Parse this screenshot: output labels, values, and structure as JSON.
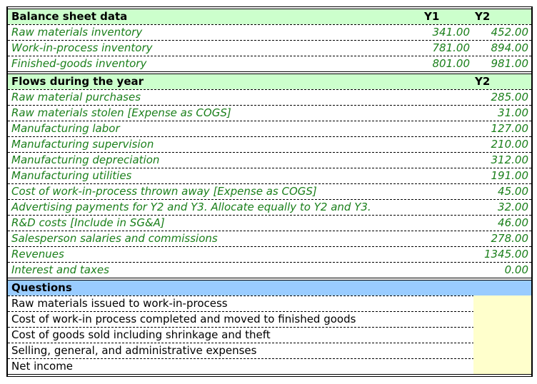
{
  "balance_sheet": {
    "title": "Balance sheet data",
    "col_y1": "Y1",
    "col_y2": "Y2",
    "rows": [
      {
        "label": "Raw materials inventory",
        "y1": "341.00",
        "y2": "452.00"
      },
      {
        "label": "Work-in-process inventory",
        "y1": "781.00",
        "y2": "894.00"
      },
      {
        "label": "Finished-goods inventory",
        "y1": "801.00",
        "y2": "981.00"
      }
    ]
  },
  "flows": {
    "title": "Flows during the year",
    "col_y2": "Y2",
    "rows": [
      {
        "label": "Raw material purchases",
        "y2": "285.00"
      },
      {
        "label": "Raw materials stolen [Expense as COGS]",
        "y2": "31.00"
      },
      {
        "label": "Manufacturing labor",
        "y2": "127.00"
      },
      {
        "label": "Manufacturing supervision",
        "y2": "210.00"
      },
      {
        "label": "Manufacturing depreciation",
        "y2": "312.00"
      },
      {
        "label": "Manufacturing utilities",
        "y2": "191.00"
      },
      {
        "label": "Cost of work-in-process thrown away [Expense as COGS]",
        "y2": "45.00"
      },
      {
        "label": "Advertising payments for Y2 and Y3. Allocate equally to Y2 and Y3.",
        "y2": "32.00"
      },
      {
        "label": "R&D costs [Include in SG&A]",
        "y2": "46.00"
      },
      {
        "label": "Salesperson salaries and commissions",
        "y2": "278.00"
      },
      {
        "label": "Revenues",
        "y2": "1345.00"
      },
      {
        "label": "Interest and taxes",
        "y2": "0.00"
      }
    ]
  },
  "questions": {
    "title": "Questions",
    "rows": [
      {
        "label": "Raw materials issued to work-in-process",
        "answer": ""
      },
      {
        "label": "Cost of work-in process completed and moved to finished goods",
        "answer": ""
      },
      {
        "label": "Cost of goods sold including shrinkage and theft",
        "answer": ""
      },
      {
        "label": "Selling, general, and administrative expenses",
        "answer": ""
      },
      {
        "label": "Net income",
        "answer": ""
      }
    ]
  },
  "colors": {
    "header_green": "#ccffcc",
    "header_blue": "#99ccff",
    "answer_yellow": "#ffffcc",
    "value_green": "#1a7f1a"
  }
}
